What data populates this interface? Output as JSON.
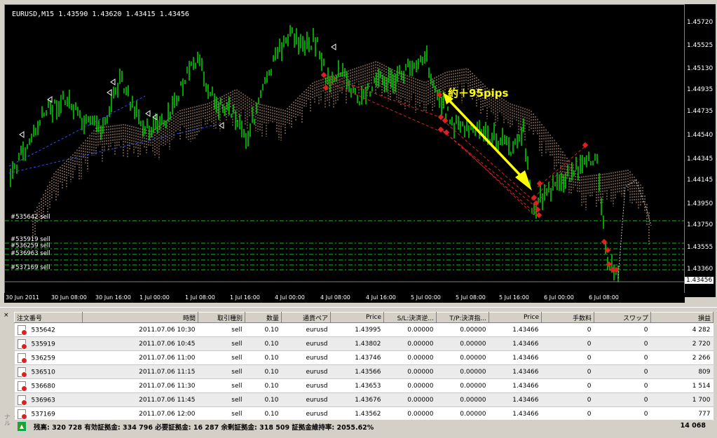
{
  "chart": {
    "header": "EURUSD,M15  1.43590 1.43620 1.43415 1.43456",
    "annotation": "約＋95pips",
    "price_ticks": [
      "1.45720",
      "1.45525",
      "1.45130",
      "1.44935",
      "1.44735",
      "1.44540",
      "1.44345",
      "1.44145",
      "1.43950",
      "1.43750",
      "1.43555",
      "1.43360"
    ],
    "current_price": "1.43456",
    "time_ticks": [
      "30 Jun 2011",
      "30 Jun 08:00",
      "30 Jun 16:00",
      "1 Jul 00:00",
      "1 Jul 08:00",
      "1 Jul 16:00",
      "4 Jul 00:00",
      "4 Jul 08:00",
      "4 Jul 16:00",
      "5 Jul 00:00",
      "5 Jul 08:00",
      "5 Jul 16:00",
      "6 Jul 00:00",
      "6 Jul 08:00"
    ],
    "order_lines": [
      "#535642 sell",
      "#535919 sell",
      "#536259 sell",
      "#536963 sell",
      "#537169 sell"
    ],
    "colors": {
      "up_bar": "#00c800",
      "down_bar": "#00c800",
      "cloud": "#ffc8a0",
      "order_line": "#00c800",
      "arrow": "#ffff00",
      "trend": "#e02020"
    }
  },
  "terminal": {
    "columns": [
      "注文番号",
      "",
      "時間",
      "取引種別",
      "数量",
      "通貨ペア",
      "Price",
      "S/L:決済逆...",
      "T/P:決済指...",
      "Price",
      "手数料",
      "スワップ",
      "損益"
    ],
    "rows": [
      {
        "id": "535642",
        "time": "2011.07.06 10:30",
        "type": "sell",
        "qty": "0.10",
        "pair": "eurusd",
        "price": "1.43995",
        "sl": "0.00000",
        "tp": "0.00000",
        "cur": "1.43466",
        "fee": "0",
        "swap": "0",
        "pl": "4 282"
      },
      {
        "id": "535919",
        "time": "2011.07.06 10:45",
        "type": "sell",
        "qty": "0.10",
        "pair": "eurusd",
        "price": "1.43802",
        "sl": "0.00000",
        "tp": "0.00000",
        "cur": "1.43466",
        "fee": "0",
        "swap": "0",
        "pl": "2 720"
      },
      {
        "id": "536259",
        "time": "2011.07.06 11:00",
        "type": "sell",
        "qty": "0.10",
        "pair": "eurusd",
        "price": "1.43746",
        "sl": "0.00000",
        "tp": "0.00000",
        "cur": "1.43466",
        "fee": "0",
        "swap": "0",
        "pl": "2 266"
      },
      {
        "id": "536510",
        "time": "2011.07.06 11:15",
        "type": "sell",
        "qty": "0.10",
        "pair": "eurusd",
        "price": "1.43566",
        "sl": "0.00000",
        "tp": "0.00000",
        "cur": "1.43466",
        "fee": "0",
        "swap": "0",
        "pl": "809"
      },
      {
        "id": "536680",
        "time": "2011.07.06 11:30",
        "type": "sell",
        "qty": "0.10",
        "pair": "eurusd",
        "price": "1.43653",
        "sl": "0.00000",
        "tp": "0.00000",
        "cur": "1.43466",
        "fee": "0",
        "swap": "0",
        "pl": "1 514"
      },
      {
        "id": "536963",
        "time": "2011.07.06 11:45",
        "type": "sell",
        "qty": "0.10",
        "pair": "eurusd",
        "price": "1.43676",
        "sl": "0.00000",
        "tp": "0.00000",
        "cur": "1.43466",
        "fee": "0",
        "swap": "0",
        "pl": "1 700"
      },
      {
        "id": "537169",
        "time": "2011.07.06 12:00",
        "type": "sell",
        "qty": "0.10",
        "pair": "eurusd",
        "price": "1.43562",
        "sl": "0.00000",
        "tp": "0.00000",
        "cur": "1.43466",
        "fee": "0",
        "swap": "0",
        "pl": "777"
      }
    ],
    "status": "残高: 320 728  有効証拠金: 334 796  必要証拠金: 16 287  余剰証拠金: 318 509  証拠金維持率: 2055.62%",
    "total": "14 068",
    "close_glyph": "×",
    "side_label": "ターミナル"
  }
}
